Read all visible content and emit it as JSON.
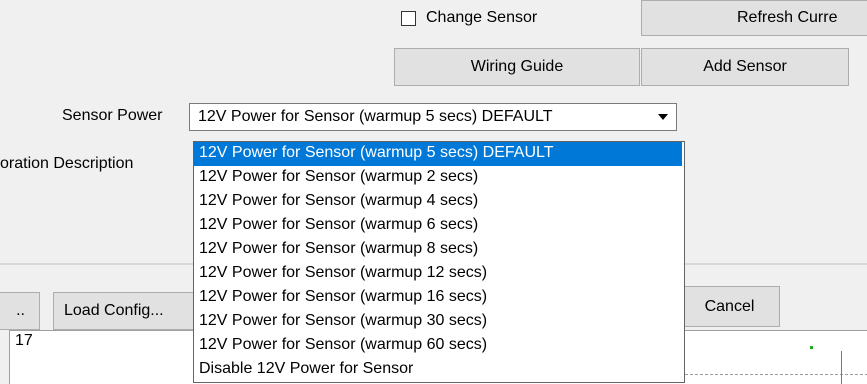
{
  "top": {
    "change_sensor_label": "Change Sensor",
    "change_sensor_checked": false,
    "refresh_button": "Refresh Curre",
    "wiring_guide_button": "Wiring Guide",
    "add_sensor_button": "Add Sensor"
  },
  "form": {
    "sensor_power_label": "Sensor Power",
    "sensor_power_value": "12V Power for Sensor (warmup 5 secs) DEFAULT",
    "calibration_description_label": "oration Description"
  },
  "dropdown": {
    "options": [
      "12V Power for Sensor (warmup 5 secs) DEFAULT",
      "12V Power for Sensor (warmup 2 secs)",
      "12V Power for Sensor (warmup 4 secs)",
      "12V Power for Sensor (warmup 6 secs)",
      "12V Power for Sensor (warmup 8 secs)",
      "12V Power for Sensor (warmup 12 secs)",
      "12V Power for Sensor (warmup 16 secs)",
      "12V Power for Sensor (warmup 30 secs)",
      "12V Power for Sensor (warmup 60 secs)",
      "Disable 12V Power for Sensor"
    ],
    "selected_index": 0
  },
  "bottom": {
    "ellipsis_button": "..",
    "load_config_button": "Load Config...",
    "cancel_button": "Cancel",
    "grid_row_number": "17"
  },
  "colors": {
    "selection": "#0078d7",
    "button_face": "#e1e1e1",
    "window_bg": "#f0f0f0"
  }
}
